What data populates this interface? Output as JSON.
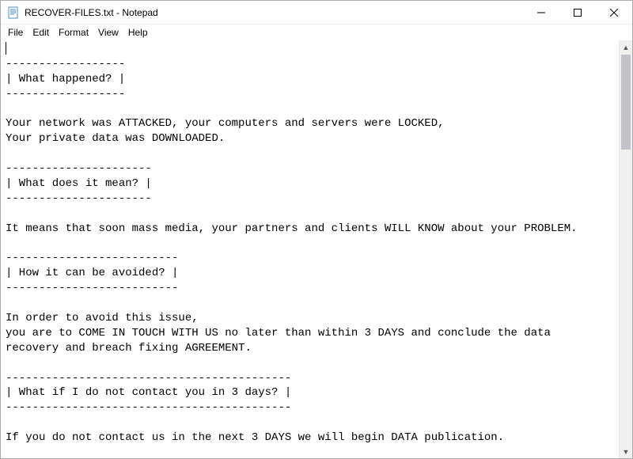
{
  "window": {
    "title": "RECOVER-FILES.txt - Notepad"
  },
  "menu": {
    "file": "File",
    "edit": "Edit",
    "format": "Format",
    "view": "View",
    "help": "Help"
  },
  "document": {
    "lines": [
      "",
      "------------------",
      "| What happened? |",
      "------------------",
      "",
      "Your network was ATTACKED, your computers and servers were LOCKED,",
      "Your private data was DOWNLOADED.",
      "",
      "----------------------",
      "| What does it mean? |",
      "----------------------",
      "",
      "It means that soon mass media, your partners and clients WILL KNOW about your PROBLEM.",
      "",
      "--------------------------",
      "| How it can be avoided? |",
      "--------------------------",
      "",
      "In order to avoid this issue,",
      "you are to COME IN TOUCH WITH US no later than within 3 DAYS and conclude the data",
      "recovery and breach fixing AGREEMENT.",
      "",
      "-------------------------------------------",
      "| What if I do not contact you in 3 days? |",
      "-------------------------------------------",
      "",
      "If you do not contact us in the next 3 DAYS we will begin DATA publication."
    ]
  }
}
